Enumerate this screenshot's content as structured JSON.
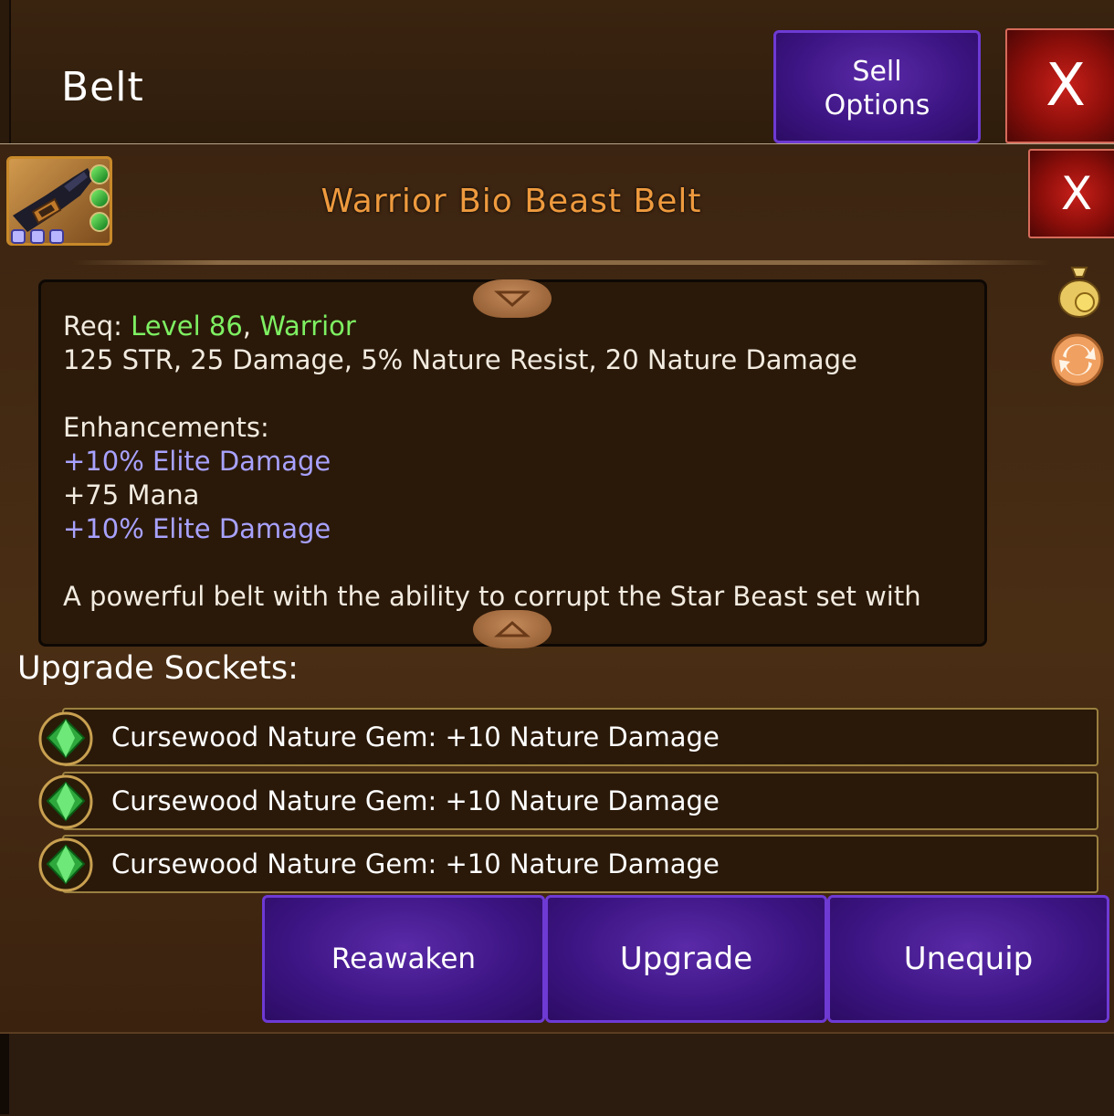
{
  "header": {
    "title": "Belt",
    "sell_options_label": "Sell\nOptions",
    "close_label": "X"
  },
  "item": {
    "name": "Warrior Bio Beast Belt",
    "close_label": "X",
    "icon": "belt-icon",
    "socket_gem_count": 3,
    "slot_dot_count": 3
  },
  "description": {
    "req_prefix": "Req: ",
    "req_level": "Level 86",
    "req_sep": ", ",
    "req_class": "Warrior",
    "stats": "125 STR, 25 Damage, 5% Nature Resist, 20 Nature Damage",
    "enhancements_title": "Enhancements:",
    "enhancements": [
      {
        "text": "+10% Elite Damage",
        "color": "#a8a2ff"
      },
      {
        "text": "+75 Mana",
        "color": "#f2ebe0"
      },
      {
        "text": "+10% Elite Damage",
        "color": "#a8a2ff"
      }
    ],
    "flavor": "A powerful belt with the ability to corrupt the Star Beast set with"
  },
  "side_icons": [
    "gold-bag-icon",
    "swap-arrows-icon"
  ],
  "sockets": {
    "label": "Upgrade Sockets:",
    "items": [
      {
        "text": "Cursewood Nature Gem: +10 Nature Damage",
        "icon": "nature-gem-icon"
      },
      {
        "text": "Cursewood Nature Gem: +10 Nature Damage",
        "icon": "nature-gem-icon"
      },
      {
        "text": "Cursewood Nature Gem: +10 Nature Damage",
        "icon": "nature-gem-icon"
      }
    ]
  },
  "actions": {
    "reawaken": "Reawaken",
    "upgrade": "Upgrade",
    "unequip": "Unequip"
  },
  "colors": {
    "item_name": "#ee9a3e",
    "requirement_met": "#7ef062",
    "enhancement_elite": "#a8a2ff",
    "button_purple": "#3c1482",
    "button_red": "#8c0e0a"
  }
}
